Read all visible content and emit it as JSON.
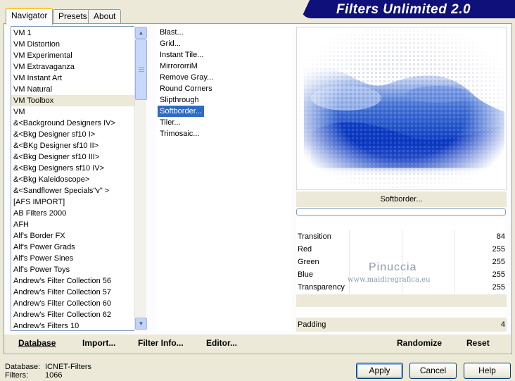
{
  "tabs": [
    "Navigator",
    "Presets",
    "About"
  ],
  "banner": {
    "title": "Filters Unlimited 2.0"
  },
  "categories": [
    "VM 1",
    "VM Distortion",
    "VM Experimental",
    "VM Extravaganza",
    "VM Instant Art",
    "VM Natural",
    "VM Toolbox",
    "VM",
    "&<Background Designers IV>",
    "&<Bkg Designer sf10 I>",
    "&<BKg Designer sf10 II>",
    "&<Bkg Designer sf10 III>",
    "&<Bkg Designers sf10 IV>",
    "&<Bkg Kaleidoscope>",
    "&<Sandflower Specials\"v\" >",
    "[AFS IMPORT]",
    "AB Filters 2000",
    "AFH",
    "Alf's Border FX",
    "Alf's Power Grads",
    "Alf's Power Sines",
    "Alf's Power Toys",
    "Andrew's Filter Collection 56",
    "Andrew's Filter Collection 57",
    "Andrew's Filter Collection 60",
    "Andrew's Filter Collection 62",
    "Andrew's Filters 10"
  ],
  "selected_category": "VM Toolbox",
  "filters": [
    "Blast...",
    "Grid...",
    "Instant Tile...",
    "MirrororriM",
    "Remove Gray...",
    "Round Corners",
    "Slipthrough",
    "Softborder...",
    "Tiler...",
    "Trimosaic..."
  ],
  "selected_filter": "Softborder...",
  "filter_title": "Softborder...",
  "params": [
    {
      "label": "Transition",
      "value": "84"
    },
    {
      "label": "Red",
      "value": "255"
    },
    {
      "label": "Green",
      "value": "255"
    },
    {
      "label": "Blue",
      "value": "255"
    },
    {
      "label": "Transparency",
      "value": "255"
    }
  ],
  "padding": {
    "label": "Padding",
    "value": "4"
  },
  "watermark": {
    "name": "Pinuccia",
    "url": "www.maidiregrafica.eu"
  },
  "bottom_buttons": {
    "database": "Database",
    "import": "Import...",
    "filter_info": "Filter Info...",
    "editor": "Editor...",
    "randomize": "Randomize",
    "reset": "Reset"
  },
  "status": {
    "database_label": "Database:",
    "database_value": "ICNET-Filters",
    "filters_label": "Filters:",
    "filters_value": "1066"
  },
  "dialog_buttons": {
    "apply": "Apply",
    "cancel": "Cancel",
    "help": "Help"
  },
  "colors": {
    "selection": "#316ac5",
    "banner": "#10107a",
    "face": "#ece9d8"
  }
}
